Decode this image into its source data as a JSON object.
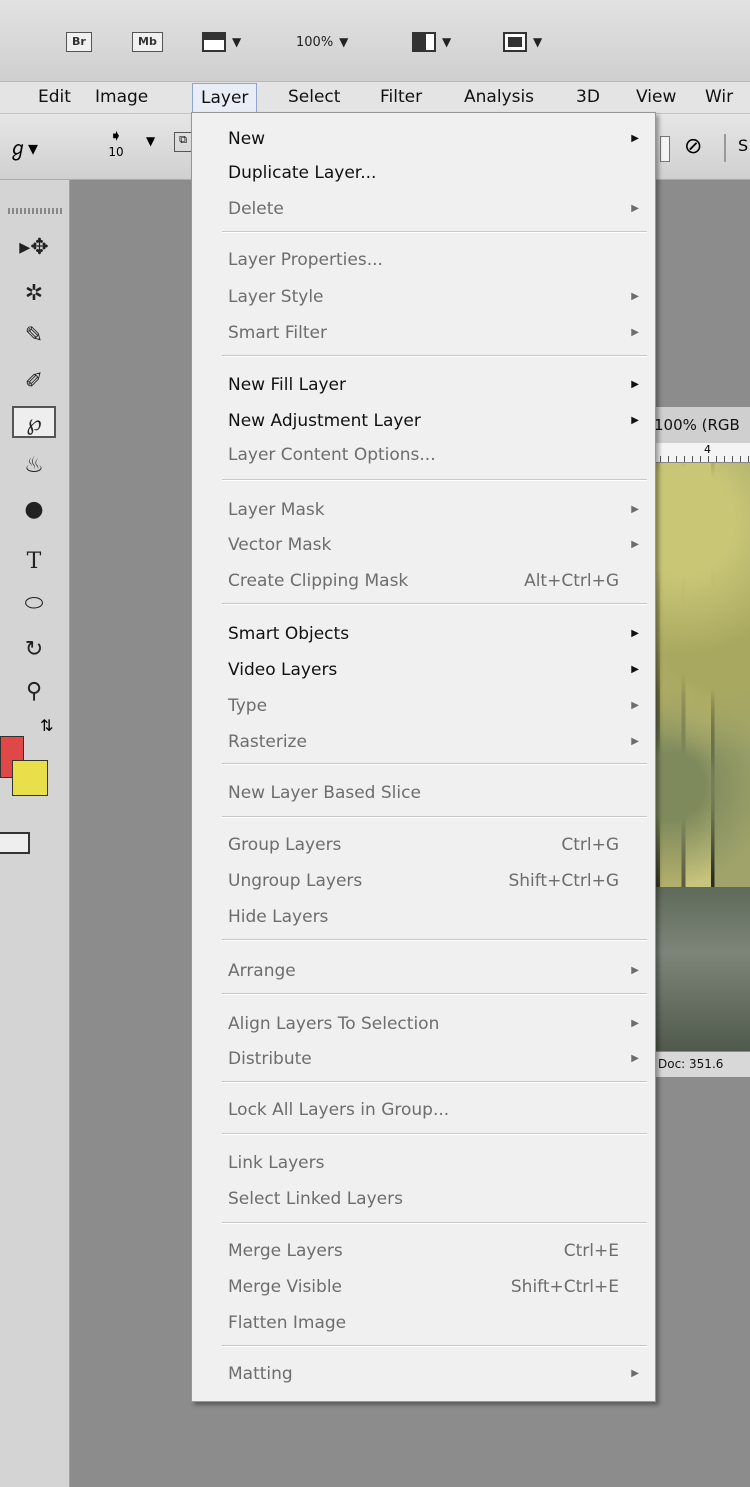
{
  "app_bar": {
    "bridge_label": "Br",
    "mini_bridge_label": "Mb",
    "zoom_value": "100%"
  },
  "menubar": {
    "items": [
      "Edit",
      "Image",
      "Layer",
      "Select",
      "Filter",
      "Analysis",
      "3D",
      "View",
      "Wir"
    ],
    "active": "Layer"
  },
  "options_bar": {
    "brush_size": "10"
  },
  "document": {
    "tab_title": "100% (RGB",
    "ruler_mark": "4",
    "status": "Doc: 351.6"
  },
  "layer_menu": {
    "items": [
      {
        "label": "New",
        "shortcut": "",
        "submenu": true,
        "enabled": true
      },
      {
        "label": "Duplicate Layer...",
        "shortcut": "",
        "submenu": false,
        "enabled": true
      },
      {
        "label": "Delete",
        "shortcut": "",
        "submenu": true,
        "enabled": false
      },
      {
        "label": "Layer Properties...",
        "shortcut": "",
        "submenu": false,
        "enabled": false
      },
      {
        "label": "Layer Style",
        "shortcut": "",
        "submenu": true,
        "enabled": false
      },
      {
        "label": "Smart Filter",
        "shortcut": "",
        "submenu": true,
        "enabled": false
      },
      {
        "label": "New Fill Layer",
        "shortcut": "",
        "submenu": true,
        "enabled": true
      },
      {
        "label": "New Adjustment Layer",
        "shortcut": "",
        "submenu": true,
        "enabled": true
      },
      {
        "label": "Layer Content Options...",
        "shortcut": "",
        "submenu": false,
        "enabled": false
      },
      {
        "label": "Layer Mask",
        "shortcut": "",
        "submenu": true,
        "enabled": false
      },
      {
        "label": "Vector Mask",
        "shortcut": "",
        "submenu": true,
        "enabled": false
      },
      {
        "label": "Create Clipping Mask",
        "shortcut": "Alt+Ctrl+G",
        "submenu": false,
        "enabled": false
      },
      {
        "label": "Smart Objects",
        "shortcut": "",
        "submenu": true,
        "enabled": true
      },
      {
        "label": "Video Layers",
        "shortcut": "",
        "submenu": true,
        "enabled": true
      },
      {
        "label": "Type",
        "shortcut": "",
        "submenu": true,
        "enabled": false
      },
      {
        "label": "Rasterize",
        "shortcut": "",
        "submenu": true,
        "enabled": false
      },
      {
        "label": "New Layer Based Slice",
        "shortcut": "",
        "submenu": false,
        "enabled": false
      },
      {
        "label": "Group Layers",
        "shortcut": "Ctrl+G",
        "submenu": false,
        "enabled": false
      },
      {
        "label": "Ungroup Layers",
        "shortcut": "Shift+Ctrl+G",
        "submenu": false,
        "enabled": false
      },
      {
        "label": "Hide Layers",
        "shortcut": "",
        "submenu": false,
        "enabled": false
      },
      {
        "label": "Arrange",
        "shortcut": "",
        "submenu": true,
        "enabled": false
      },
      {
        "label": "Align Layers To Selection",
        "shortcut": "",
        "submenu": true,
        "enabled": false
      },
      {
        "label": "Distribute",
        "shortcut": "",
        "submenu": true,
        "enabled": false
      },
      {
        "label": "Lock All Layers in Group...",
        "shortcut": "",
        "submenu": false,
        "enabled": false
      },
      {
        "label": "Link Layers",
        "shortcut": "",
        "submenu": false,
        "enabled": false
      },
      {
        "label": "Select Linked Layers",
        "shortcut": "",
        "submenu": false,
        "enabled": false
      },
      {
        "label": "Merge Layers",
        "shortcut": "Ctrl+E",
        "submenu": false,
        "enabled": false
      },
      {
        "label": "Merge Visible",
        "shortcut": "Shift+Ctrl+E",
        "submenu": false,
        "enabled": false
      },
      {
        "label": "Flatten Image",
        "shortcut": "",
        "submenu": false,
        "enabled": false
      },
      {
        "label": "Matting",
        "shortcut": "",
        "submenu": true,
        "enabled": false
      }
    ]
  },
  "colors": {
    "foreground_swatch": "#e04848",
    "background_swatch": "#e8df4a"
  }
}
